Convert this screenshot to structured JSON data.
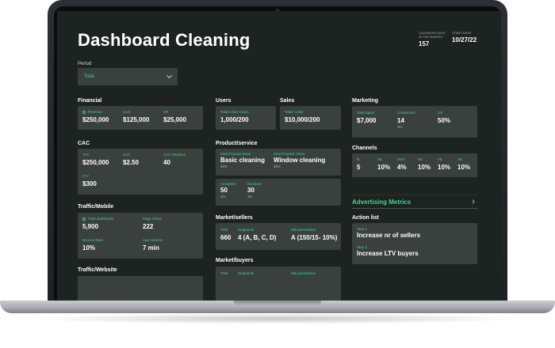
{
  "title": "Dashboard Cleaning",
  "stats": {
    "calendar_label": "Calendar days in the market",
    "calendar_value": "157",
    "start_label": "Start date",
    "start_value": "10/27/22"
  },
  "period": {
    "label": "Period",
    "value": "Total"
  },
  "financial": {
    "title": "Financial",
    "items": [
      {
        "label": "Revenue",
        "value": "$250,000"
      },
      {
        "label": "Cost",
        "value": "$125,000"
      },
      {
        "label": "GP",
        "value": "$25,000"
      }
    ]
  },
  "cac": {
    "title": "CAC",
    "items": [
      {
        "label": "TAC",
        "value": "$250,000"
      },
      {
        "label": "CAC",
        "value": "$2.50"
      },
      {
        "label": "CAC Payback",
        "value": "40"
      },
      {
        "label": "LTV",
        "value": "$300"
      }
    ]
  },
  "traffic_mobile": {
    "title": "Traffic/Mobile",
    "items": [
      {
        "label": "Total downloads",
        "value": "5,900"
      },
      {
        "label": "Page Views",
        "value": "222"
      },
      {
        "label": "Bounce Rate",
        "value": "10%"
      },
      {
        "label": "Avg. session",
        "value": "7 min"
      }
    ]
  },
  "traffic_website": {
    "title": "Traffic/Website"
  },
  "users": {
    "title": "Users",
    "label": "Total Active Users",
    "value": "1,000/200"
  },
  "sales": {
    "title": "Sales",
    "label": "Total / Units",
    "value": "$10,000/200"
  },
  "product_service": {
    "title": "Product/service",
    "most_popular_basic": {
      "label": "Most Popular Basic",
      "value": "Basic cleaning",
      "sub": "36%"
    },
    "most_popular_clean": {
      "label": "Most Popular Clean",
      "value": "Window cleaning",
      "sub": "30%"
    },
    "accepted": {
      "label": "Accepted",
      "value": "50",
      "sub": "3%"
    },
    "declined": {
      "label": "Declined",
      "value": "30",
      "sub": "3%"
    }
  },
  "market_sellers": {
    "title": "Market/sellers",
    "items": [
      {
        "label": "TAM",
        "value": "660"
      },
      {
        "label": "Segments",
        "value": "4 (A, B, C, D)"
      },
      {
        "label": "Mkt penetration",
        "value": "A (150/15- 10%)"
      }
    ]
  },
  "market_buyers": {
    "title": "Market/buyers",
    "items": [
      {
        "label": "TAM"
      },
      {
        "label": "Segments"
      },
      {
        "label": "Mkt penetration"
      }
    ]
  },
  "marketing": {
    "title": "Marketing",
    "items": [
      {
        "label": "Total Spent",
        "value": "$7,000"
      },
      {
        "label": "Conversion",
        "value": "14",
        "sub": "3%"
      },
      {
        "label": "GP",
        "value": "50%"
      }
    ]
  },
  "channels": {
    "title": "Channels",
    "items": [
      {
        "label": "fb",
        "value": "5"
      },
      {
        "label": "FB",
        "value": "10%"
      },
      {
        "label": "INST",
        "value": "4%"
      },
      {
        "label": "FB",
        "value": "10%"
      },
      {
        "label": "FB",
        "value": "10%"
      },
      {
        "label": "FB",
        "value": "10%"
      }
    ]
  },
  "advertising": {
    "label": "Advertising Metrics"
  },
  "action_list": {
    "title": "Action list",
    "items": [
      {
        "label": "Step 1",
        "value": "Increase  nr of sellers"
      },
      {
        "label": "Step 2",
        "value": "Increase  LTV buyers"
      }
    ]
  },
  "colors": {
    "accent": "#3fd48b",
    "background": "#1d2321",
    "card": "#3a403e"
  }
}
